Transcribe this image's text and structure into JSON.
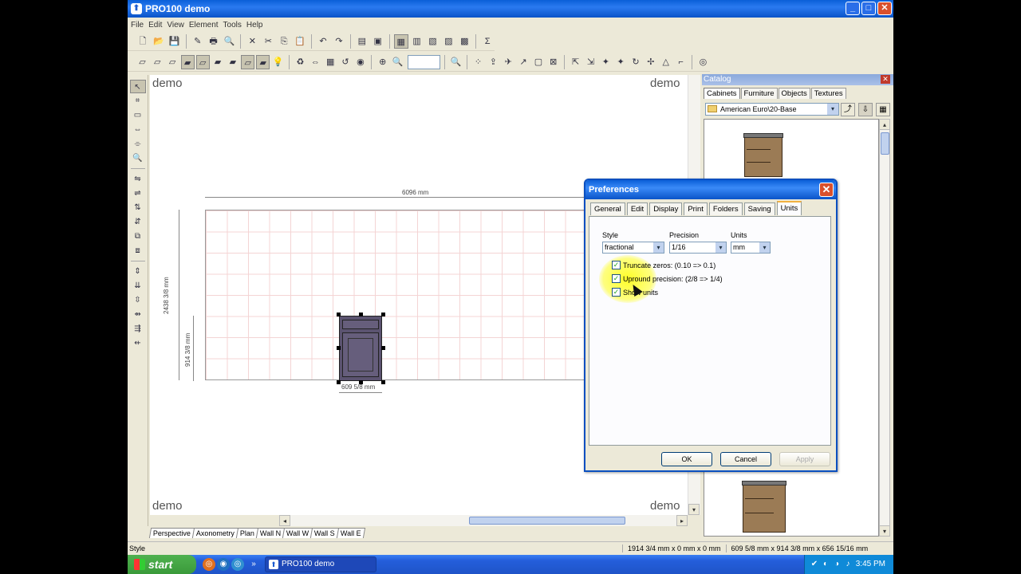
{
  "window": {
    "title": "PRO100 demo",
    "app_glyph": "⬆",
    "minimize": "_",
    "maximize": "□",
    "close": "✕"
  },
  "menu": [
    "File",
    "Edit",
    "View",
    "Element",
    "Tools",
    "Help"
  ],
  "toolbar1_icons": [
    "new-icon",
    "open-icon",
    "save-icon",
    "edit-icon",
    "print-icon",
    "print-preview-icon",
    "cut-icon",
    "scissors-icon",
    "copy-icon",
    "paste-icon",
    "undo-icon",
    "redo-icon",
    "properties-icon",
    "export-icon",
    "view1-icon",
    "view2-icon",
    "view3-icon",
    "view4-icon",
    "view5-icon",
    "sum-icon"
  ],
  "toolbar1_glyphs": [
    "🗋",
    "📂",
    "💾",
    "✎",
    "🖶",
    "🔍",
    "✕",
    "✂",
    "⎘",
    "📋",
    "↶",
    "↷",
    "▤",
    "▣",
    "▦",
    "▥",
    "▧",
    "▨",
    "▩",
    "Σ"
  ],
  "toolbar2_glyphs": [
    "▱",
    "▱",
    "▱",
    "▰",
    "▱",
    "▰",
    "▰",
    "▱",
    "▰",
    "💡",
    "♻",
    "⇔",
    "▦",
    "↺",
    "◉",
    "⊕",
    "🔍",
    "🔍",
    "⁘",
    "⇪",
    "✈",
    "↗",
    "▢",
    "⊠",
    "⇱",
    "⇲",
    "✦",
    "✦",
    "↻",
    "✢",
    "△",
    "⌐",
    "◎"
  ],
  "lefttb_glyphs": [
    "↖",
    "⌗",
    "▭",
    "⇔",
    "⌯",
    "🔍",
    "⇋",
    "⇌",
    "⇅",
    "⇵",
    "⧉",
    "⧈",
    "⇕",
    "⇊",
    "⇳",
    "⇴",
    "⇶",
    "⇷"
  ],
  "canvas": {
    "watermark": "demo",
    "dim_width": "6096 mm",
    "dim_height": "2438 3/8 mm",
    "dim_cab_height": "914 3/8 mm",
    "dim_cab_width": "609 5/8 mm"
  },
  "view_tabs": [
    "Perspective",
    "Axonometry",
    "Plan",
    "Wall N",
    "Wall W",
    "Wall S",
    "Wall E"
  ],
  "status": {
    "left": "Style",
    "coords": "1914 3/4 mm x 0 mm x 0 mm",
    "size": "609 5/8 mm x 914 3/8 mm x 656 15/16 mm"
  },
  "catalog": {
    "title": "Catalog",
    "close": "✕",
    "tabs": [
      "Cabinets",
      "Furniture",
      "Objects",
      "Textures"
    ],
    "active_tab": "Cabinets",
    "folder": "American Euro\\20-Base",
    "buttons": [
      "⤴",
      "⇩",
      "▦"
    ],
    "arrows": {
      "dropdown": "▾",
      "up": "▴",
      "down": "▾",
      "left": "◂",
      "right": "▸"
    }
  },
  "preferences": {
    "title": "Preferences",
    "close": "✕",
    "tabs": [
      "General",
      "Edit",
      "Display",
      "Print",
      "Folders",
      "Saving",
      "Units"
    ],
    "active_tab": "Units",
    "style_label": "Style",
    "style_value": "fractional",
    "precision_label": "Precision",
    "precision_value": "1/16",
    "units_label": "Units",
    "units_value": "mm",
    "checkboxes": [
      {
        "label": "Truncate zeros:  (0.10 => 0.1)",
        "checked": true
      },
      {
        "label": "Upround  precision:  (2/8 => 1/4)",
        "checked": true
      },
      {
        "label": "Show units",
        "checked": true
      }
    ],
    "check_glyph": "✓",
    "dropdown_arrow": "▾",
    "ok": "OK",
    "cancel": "Cancel",
    "apply": "Apply"
  },
  "taskbar": {
    "start": "start",
    "task": "PRO100 demo",
    "time": "3:45 PM",
    "quicklaunch": [
      "◎",
      "◉",
      "◎"
    ],
    "more": "»",
    "tray": [
      "✔",
      "◐",
      "◑",
      "♪"
    ]
  },
  "colors": {
    "titlebar": "#0a5fd8",
    "cabinet": "#5b5370",
    "grid": "#f4d4d4",
    "highlight": "#ffff00"
  }
}
